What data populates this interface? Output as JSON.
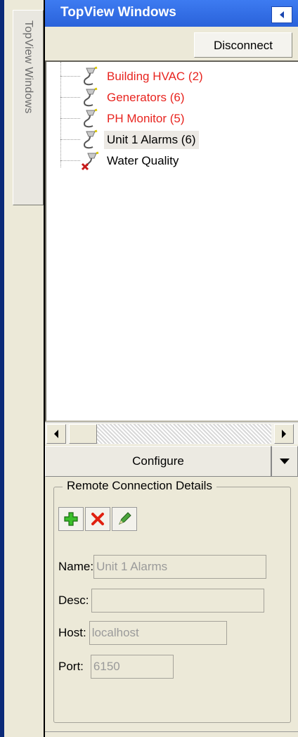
{
  "side_tab": {
    "label": "TopView Windows"
  },
  "panel": {
    "title": "TopView Windows",
    "disconnect_label": "Disconnect",
    "tree_items": [
      {
        "label": "Building HVAC (2)",
        "color": "#e8241f",
        "state": "alarm"
      },
      {
        "label": "Generators (6)",
        "color": "#e8241f",
        "state": "alarm"
      },
      {
        "label": "PH Monitor (5)",
        "color": "#e8241f",
        "state": "alarm"
      },
      {
        "label": "Unit 1 Alarms (6)",
        "color": "#000000",
        "state": "selected"
      },
      {
        "label": "Water Quality",
        "color": "#000000",
        "state": "disconnected"
      }
    ],
    "configure_label": "Configure"
  },
  "details": {
    "group_title": "Remote Connection Details",
    "icons": [
      "add-icon",
      "delete-icon",
      "edit-icon"
    ],
    "name_label": "Name:",
    "name_value": "Unit 1 Alarms",
    "desc_label": "Desc:",
    "desc_value": "",
    "host_label": "Host:",
    "host_value": "localhost",
    "port_label": "Port:",
    "port_value": "6150"
  },
  "colors": {
    "title_bar": "#2a62da",
    "alarm_text": "#e8241f"
  }
}
